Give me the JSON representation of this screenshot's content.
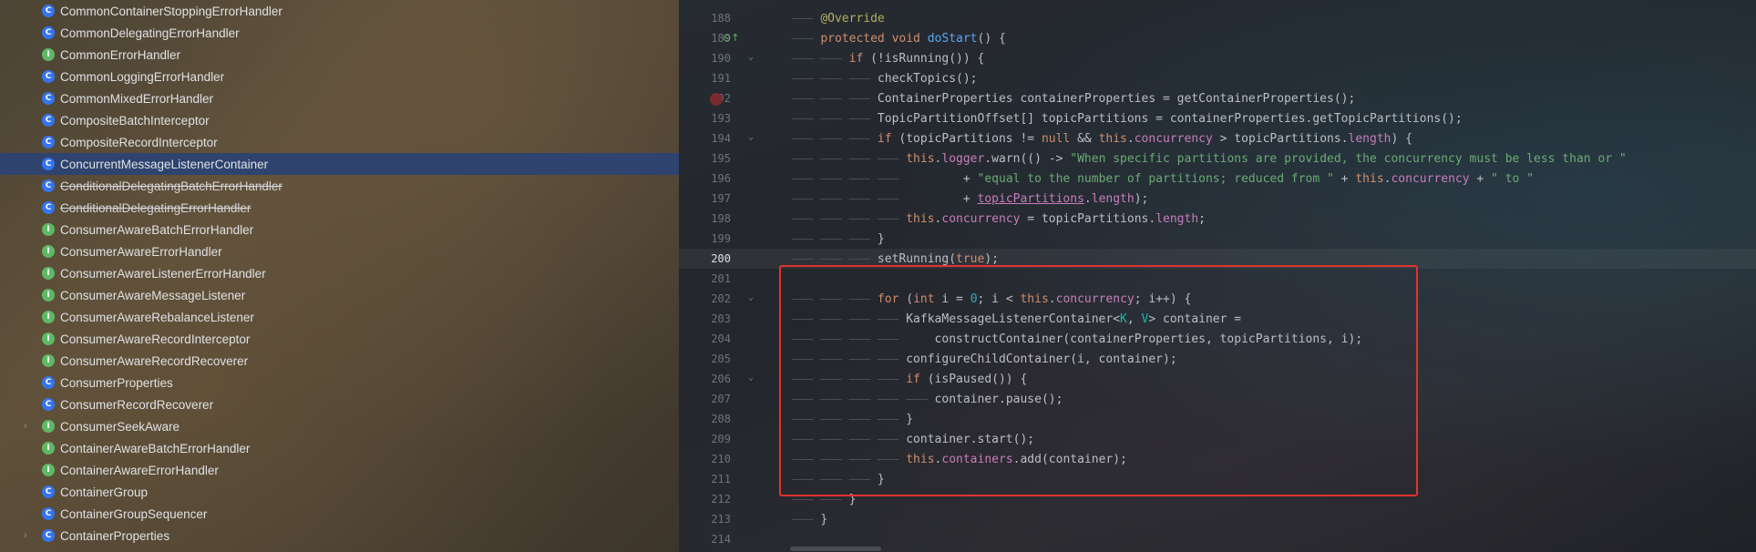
{
  "tree": {
    "items": [
      {
        "label": "CommonContainerStoppingErrorHandler",
        "kind": "class"
      },
      {
        "label": "CommonDelegatingErrorHandler",
        "kind": "class"
      },
      {
        "label": "CommonErrorHandler",
        "kind": "interface"
      },
      {
        "label": "CommonLoggingErrorHandler",
        "kind": "class"
      },
      {
        "label": "CommonMixedErrorHandler",
        "kind": "class"
      },
      {
        "label": "CompositeBatchInterceptor",
        "kind": "class"
      },
      {
        "label": "CompositeRecordInterceptor",
        "kind": "class"
      },
      {
        "label": "ConcurrentMessageListenerContainer",
        "kind": "class",
        "selected": true
      },
      {
        "label": "ConditionalDelegatingBatchErrorHandler",
        "kind": "class",
        "deprecated": true
      },
      {
        "label": "ConditionalDelegatingErrorHandler",
        "kind": "class",
        "deprecated": true
      },
      {
        "label": "ConsumerAwareBatchErrorHandler",
        "kind": "interface"
      },
      {
        "label": "ConsumerAwareErrorHandler",
        "kind": "interface"
      },
      {
        "label": "ConsumerAwareListenerErrorHandler",
        "kind": "interface"
      },
      {
        "label": "ConsumerAwareMessageListener",
        "kind": "interface"
      },
      {
        "label": "ConsumerAwareRebalanceListener",
        "kind": "interface"
      },
      {
        "label": "ConsumerAwareRecordInterceptor",
        "kind": "interface"
      },
      {
        "label": "ConsumerAwareRecordRecoverer",
        "kind": "interface"
      },
      {
        "label": "ConsumerProperties",
        "kind": "class"
      },
      {
        "label": "ConsumerRecordRecoverer",
        "kind": "class"
      },
      {
        "label": "ConsumerSeekAware",
        "kind": "interface",
        "expandable": true
      },
      {
        "label": "ContainerAwareBatchErrorHandler",
        "kind": "interface"
      },
      {
        "label": "ContainerAwareErrorHandler",
        "kind": "interface"
      },
      {
        "label": "ContainerGroup",
        "kind": "class"
      },
      {
        "label": "ContainerGroupSequencer",
        "kind": "class"
      },
      {
        "label": "ContainerProperties",
        "kind": "class",
        "expandable": true
      }
    ]
  },
  "editor": {
    "current_line": "200",
    "lines": [
      {
        "n": "188",
        "g": "——— ",
        "html": "<span class=\"ann\">@Override</span>"
      },
      {
        "n": "189",
        "g": "——— ",
        "html": "<span class=\"kw\">protected void </span><span class=\"fn\">doStart</span>() {"
      },
      {
        "n": "190",
        "g": "——— ——— ",
        "html": "<span class=\"kw\">if </span>(!isRunning()) {"
      },
      {
        "n": "191",
        "g": "——— ——— ——— ",
        "html": "checkTopics();"
      },
      {
        "n": "192",
        "g": "——— ——— ——— ",
        "html": "ContainerProperties containerProperties = getContainerProperties();"
      },
      {
        "n": "193",
        "g": "——— ——— ——— ",
        "html": "TopicPartitionOffset[] topicPartitions = containerProperties.getTopicPartitions();"
      },
      {
        "n": "194",
        "g": "——— ——— ——— ",
        "html": "<span class=\"kw\">if </span>(topicPartitions != <span class=\"kw\">null </span>&amp;&amp; <span class=\"kw\">this</span>.<span class=\"fld\">concurrency</span> &gt; topicPartitions.<span class=\"fld\">length</span>) {"
      },
      {
        "n": "195",
        "g": "——— ——— ——— ——— ",
        "html": "<span class=\"kw\">this</span>.<span class=\"fld\">logger</span>.warn(() -&gt; <span class=\"str\">\"When specific partitions are provided, the concurrency must be less than or \"</span>"
      },
      {
        "n": "196",
        "g": "——— ——— ——— ——— ",
        "html": "        + <span class=\"str\">\"equal to the number of partitions; reduced from \"</span> + <span class=\"kw\">this</span>.<span class=\"fld\">concurrency</span> + <span class=\"str\">\" to \"</span>"
      },
      {
        "n": "197",
        "g": "——— ——— ——— ——— ",
        "html": "        + <span class=\"fld u\">topicPartitions</span>.<span class=\"fld\">length</span>);"
      },
      {
        "n": "198",
        "g": "——— ——— ——— ——— ",
        "html": "<span class=\"kw\">this</span>.<span class=\"fld\">concurrency</span> = topicPartitions.<span class=\"fld\">length</span>;"
      },
      {
        "n": "199",
        "g": "——— ——— ——— ",
        "html": "}"
      },
      {
        "n": "200",
        "g": "——— ——— ——— ",
        "html": "setRunning(<span class=\"kw\">true</span>);"
      },
      {
        "n": "201",
        "g": "",
        "html": ""
      },
      {
        "n": "202",
        "g": "——— ——— ——— ",
        "html": "<span class=\"kw\">for </span>(<span class=\"kw\">int </span>i = <span class=\"num\">0</span>; i &lt; <span class=\"kw\">this</span>.<span class=\"fld\">concurrency</span>; i++) {"
      },
      {
        "n": "203",
        "g": "——— ——— ——— ——— ",
        "html": "KafkaMessageListenerContainer&lt;<span class=\"tp\">K</span>, <span class=\"tp\">V</span>&gt; container ="
      },
      {
        "n": "204",
        "g": "——— ——— ——— ——— ",
        "html": "    constructContainer(containerProperties, topicPartitions, i);"
      },
      {
        "n": "205",
        "g": "——— ——— ——— ——— ",
        "html": "configureChildContainer(i, container);"
      },
      {
        "n": "206",
        "g": "——— ——— ——— ——— ",
        "html": "<span class=\"kw\">if </span>(isPaused()) {"
      },
      {
        "n": "207",
        "g": "——— ——— ——— ——— ——— ",
        "html": "container.pause();"
      },
      {
        "n": "208",
        "g": "——— ——— ——— ——— ",
        "html": "}"
      },
      {
        "n": "209",
        "g": "——— ——— ——— ——— ",
        "html": "container.start();"
      },
      {
        "n": "210",
        "g": "——— ——— ——— ——— ",
        "html": "<span class=\"kw\">this</span>.<span class=\"fld\">containers</span>.add(container);"
      },
      {
        "n": "211",
        "g": "——— ——— ——— ",
        "html": "}"
      },
      {
        "n": "212",
        "g": "——— ——— ",
        "html": "}"
      },
      {
        "n": "213",
        "g": "——— ",
        "html": "}"
      },
      {
        "n": "214",
        "g": "",
        "html": ""
      }
    ]
  },
  "colors": {
    "selection": "#2e436e",
    "class_icon": "#3574f0",
    "interface_icon": "#5fb865",
    "highlight_box": "#e0332e"
  },
  "icons": {
    "class": "class-icon",
    "interface": "interface-icon",
    "override_gutter": "override-icon",
    "breakpoint": "breakpoint-icon"
  }
}
